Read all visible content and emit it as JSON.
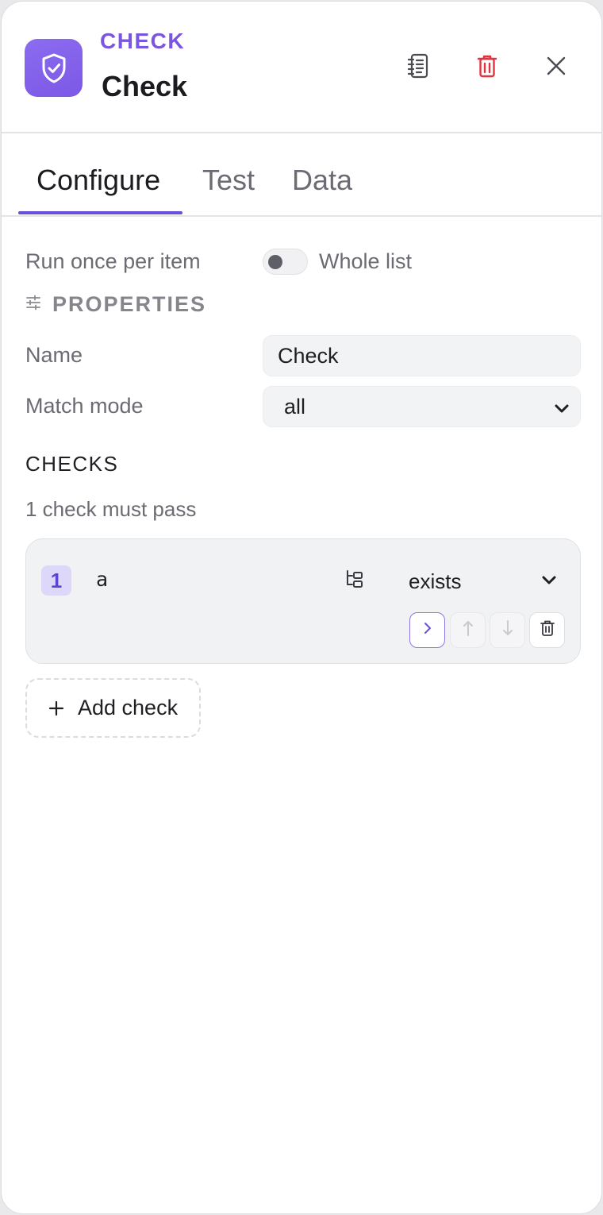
{
  "header": {
    "kind": "CHECK",
    "title": "Check",
    "icons": {
      "node": "shield-check-icon",
      "docs": "notebook-icon",
      "delete": "trash-icon",
      "close": "close-icon"
    },
    "colors": {
      "accent": "#7a55e0",
      "danger": "#e2343f"
    }
  },
  "tabs": [
    {
      "label": "Configure",
      "active": true
    },
    {
      "label": "Test",
      "active": false
    },
    {
      "label": "Data",
      "active": false
    }
  ],
  "run_mode": {
    "label": "Run once per item",
    "toggle_label": "Whole list",
    "toggle_on": false
  },
  "properties": {
    "section_title": "PROPERTIES",
    "section_icon": "sliders-icon",
    "name_label": "Name",
    "name_value": "Check",
    "match_mode_label": "Match mode",
    "match_mode_value": "all"
  },
  "checks": {
    "title": "CHECKS",
    "subtitle": "1 check must pass",
    "items": [
      {
        "index": "1",
        "field": "a",
        "operator": "exists"
      }
    ],
    "add_label": "Add check"
  }
}
